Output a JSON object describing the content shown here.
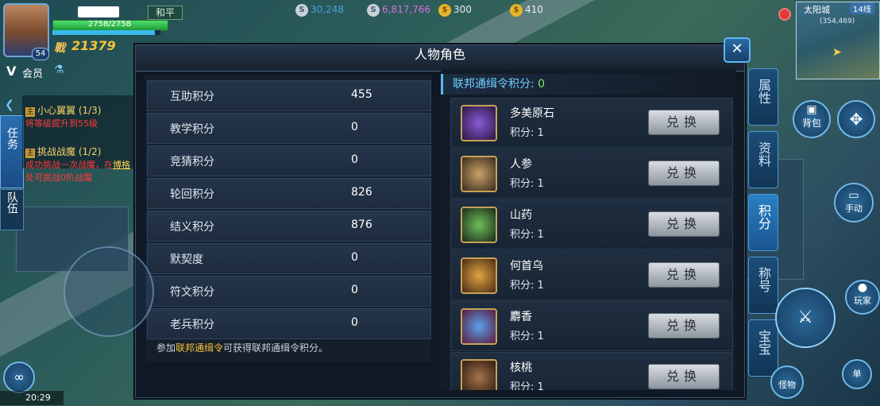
{
  "hud": {
    "camp": "和平",
    "hp_text": "2758/2758",
    "hp_fraction": 1.0,
    "mp_fraction": 0.95,
    "power_icon": "戰",
    "power": "21379",
    "level": "54",
    "vip_label": "会员",
    "currencies": [
      {
        "icon": "silver-coin-icon",
        "value": "30,248",
        "color": "#4a9fe0"
      },
      {
        "icon": "bound-coin-icon",
        "value": "6,817,766",
        "color": "#d46ee6"
      },
      {
        "icon": "gold-coin-icon",
        "value": "300",
        "color": "#ffffff"
      },
      {
        "icon": "gold-ingot-icon",
        "value": "410",
        "color": "#ffffff"
      }
    ]
  },
  "minimap": {
    "city": "太阳城",
    "line": "14线",
    "coords": "(354,469)"
  },
  "quests": {
    "tab_label": "任务",
    "team_label": "队伍",
    "items": [
      {
        "tag": "主",
        "title": "小心翼翼 (1/3)",
        "desc": "将等级提升到55级"
      },
      {
        "tag": "主",
        "title": "挑战战魔 (1/2)",
        "desc_1": "成功挑战一次战魔，在",
        "desc_link": "博格",
        "desc_2": "处可挑战0阶战魔"
      }
    ]
  },
  "dialog": {
    "title": "人物角色",
    "close": "✕",
    "stats": [
      {
        "name": "互助积分",
        "value": "455"
      },
      {
        "name": "教学积分",
        "value": "0"
      },
      {
        "name": "竞猜积分",
        "value": "0"
      },
      {
        "name": "轮回积分",
        "value": "826"
      },
      {
        "name": "结义积分",
        "value": "876"
      },
      {
        "name": "默契度",
        "value": "0"
      },
      {
        "name": "符文积分",
        "value": "0"
      },
      {
        "name": "老兵积分",
        "value": "0"
      }
    ],
    "footer_prefix": "参加",
    "footer_highlight": "联邦通缉令",
    "footer_suffix": "可获得联邦通缉令积分。",
    "points_label": "联邦通缉令积分:",
    "points_value": "0",
    "exchange_items": [
      {
        "name": "多美原石",
        "cost": "积分: 1",
        "button": "兑换",
        "icon": "purple-gem-icon",
        "color": "#6b3fb0"
      },
      {
        "name": "人参",
        "cost": "积分: 1",
        "button": "兑换",
        "icon": "ginseng-icon",
        "color": "#8a6a3a"
      },
      {
        "name": "山药",
        "cost": "积分: 1",
        "button": "兑换",
        "icon": "yam-vine-icon",
        "color": "#3a6a3a"
      },
      {
        "name": "何首乌",
        "cost": "积分: 1",
        "button": "兑换",
        "icon": "fleeceflower-root-icon",
        "color": "#a8742a"
      },
      {
        "name": "麝香",
        "cost": "积分: 1",
        "button": "兑换",
        "icon": "musk-pouch-icon",
        "color": "#3a6fc4"
      },
      {
        "name": "核桃",
        "cost": "积分: 1",
        "button": "兑换",
        "icon": "walnut-icon",
        "color": "#7a4a2a"
      }
    ]
  },
  "side_tabs": [
    {
      "label": "属性",
      "active": false
    },
    {
      "label": "资料",
      "active": false
    },
    {
      "label": "积分",
      "active": true
    },
    {
      "label": "称号",
      "active": false
    },
    {
      "label": "宝宝",
      "active": false
    }
  ],
  "right_buttons": {
    "bag": "背包",
    "auto": "手动",
    "player": "玩家",
    "monster": "怪物",
    "single": "单"
  },
  "status_bar": {
    "time": "20:29"
  }
}
